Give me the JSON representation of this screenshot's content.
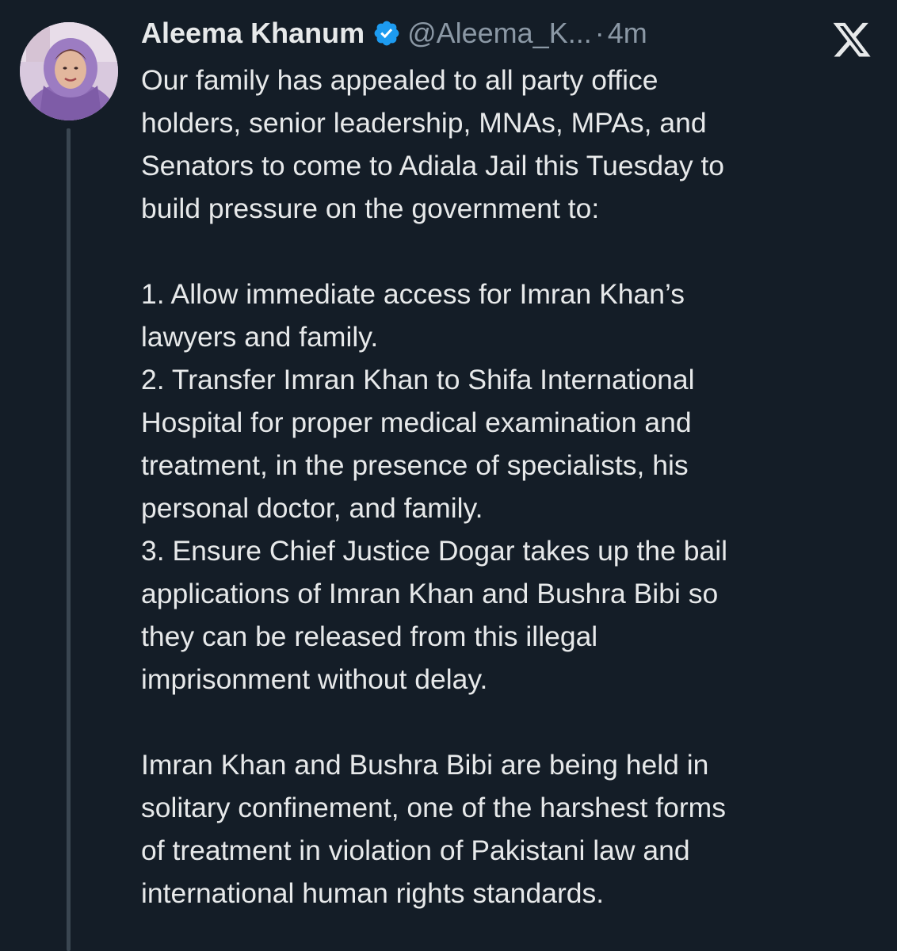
{
  "tweet": {
    "author_name": "Aleema Khanum",
    "handle": "@Aleema_K...",
    "separator": "·",
    "time": "4m",
    "verified": true,
    "platform_icon": "x-logo-icon",
    "verified_icon": "verified-badge-icon",
    "accent_color": "#1d9bf0",
    "body_lines": [
      "Our family has appealed to all party office",
      "holders, senior leadership, MNAs, MPAs, and",
      "Senators to come to Adiala Jail this Tuesday to",
      "build pressure on the government to:",
      "",
      "1. Allow immediate access for Imran Khan’s",
      "lawyers and family.",
      "2. Transfer Imran Khan to Shifa International",
      "Hospital for proper medical examination and",
      "treatment, in the presence of specialists, his",
      "personal doctor, and family.",
      "3. Ensure Chief Justice Dogar takes up the bail",
      "applications of Imran Khan and Bushra Bibi so",
      "they can be released from this illegal",
      "imprisonment without delay.",
      "",
      "Imran Khan and Bushra Bibi are being held in",
      "solitary confinement, one of the harshest forms",
      "of treatment in violation of Pakistani law and",
      "international human rights standards."
    ]
  }
}
